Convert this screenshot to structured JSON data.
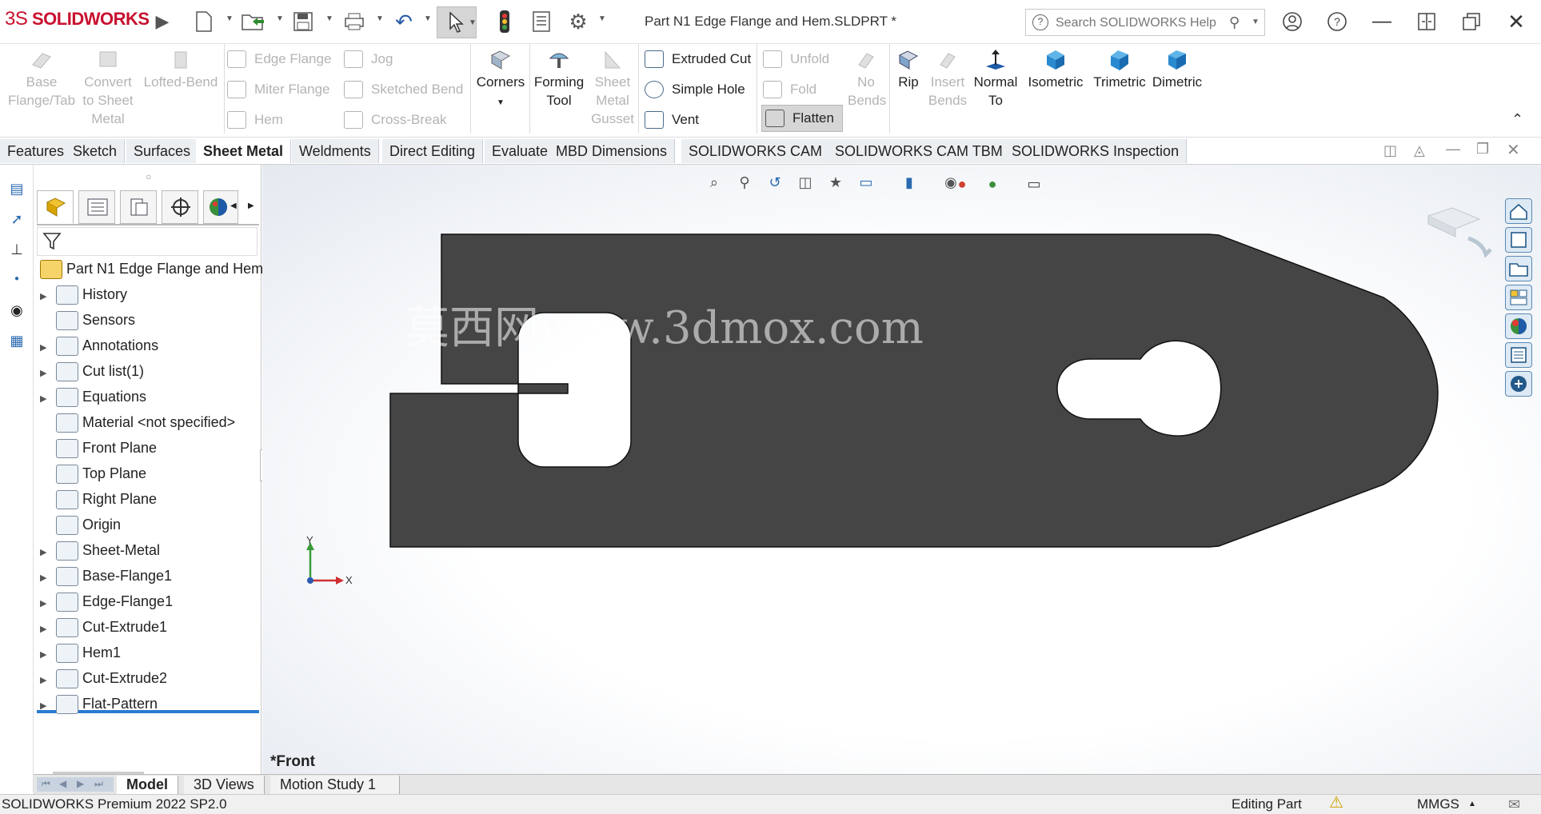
{
  "app": {
    "brand_ds": "3S",
    "brand_name": "SOLIDWORKS"
  },
  "document": {
    "title": "Part N1 Edge Flange and Hem.SLDPRT *"
  },
  "search": {
    "placeholder": "Search SOLIDWORKS Help"
  },
  "ribbon": {
    "base_flange": [
      "Base",
      "Flange/Tab"
    ],
    "convert": [
      "Convert",
      "to Sheet",
      "Metal"
    ],
    "lofted_bend": "Lofted-Bend",
    "edge_flange": "Edge Flange",
    "miter_flange": "Miter Flange",
    "hem": "Hem",
    "jog": "Jog",
    "sketched_bend": "Sketched Bend",
    "cross_break": "Cross-Break",
    "corners": "Corners",
    "forming_tool": [
      "Forming",
      "Tool"
    ],
    "sm_gusset": [
      "Sheet",
      "Metal",
      "Gusset"
    ],
    "extruded_cut": "Extruded Cut",
    "simple_hole": "Simple Hole",
    "vent": "Vent",
    "unfold": "Unfold",
    "fold": "Fold",
    "flatten": "Flatten",
    "no_bends": [
      "No",
      "Bends"
    ],
    "rip": "Rip",
    "insert_bends": [
      "Insert",
      "Bends"
    ],
    "normal_to": [
      "Normal",
      "To"
    ],
    "isometric": "Isometric",
    "trimetric": "Trimetric",
    "dimetric": "Dimetric"
  },
  "tabs": [
    "Features",
    "Sketch",
    "Surfaces",
    "Sheet Metal",
    "Weldments",
    "Direct Editing",
    "Evaluate",
    "MBD Dimensions",
    "SOLIDWORKS CAM",
    "SOLIDWORKS CAM TBM",
    "SOLIDWORKS Inspection"
  ],
  "active_tab": "Sheet Metal",
  "tree": {
    "root": "Part N1 Edge Flange and Hem",
    "items": [
      {
        "label": "History",
        "expandable": true
      },
      {
        "label": "Sensors",
        "expandable": false
      },
      {
        "label": "Annotations",
        "expandable": true
      },
      {
        "label": "Cut list(1)",
        "expandable": true
      },
      {
        "label": "Equations",
        "expandable": true
      },
      {
        "label": "Material <not specified>",
        "expandable": false
      },
      {
        "label": "Front Plane",
        "expandable": false
      },
      {
        "label": "Top Plane",
        "expandable": false
      },
      {
        "label": "Right Plane",
        "expandable": false
      },
      {
        "label": "Origin",
        "expandable": false
      },
      {
        "label": "Sheet-Metal",
        "expandable": true
      },
      {
        "label": "Base-Flange1",
        "expandable": true
      },
      {
        "label": "Edge-Flange1",
        "expandable": true
      },
      {
        "label": "Cut-Extrude1",
        "expandable": true
      },
      {
        "label": "Hem1",
        "expandable": true
      },
      {
        "label": "Cut-Extrude2",
        "expandable": true
      },
      {
        "label": "Flat-Pattern",
        "expandable": true
      }
    ]
  },
  "viewport": {
    "view_label": "*Front",
    "watermark": "莫西网www.3dmox.com",
    "axis_x": "X",
    "axis_y": "Y",
    "part_color": "#454545"
  },
  "bottom_tabs": [
    "Model",
    "3D Views",
    "Motion Study 1"
  ],
  "active_bottom_tab": "Model",
  "status": {
    "version": "SOLIDWORKS Premium 2022 SP2.0",
    "mode": "Editing Part",
    "units": "MMGS"
  }
}
